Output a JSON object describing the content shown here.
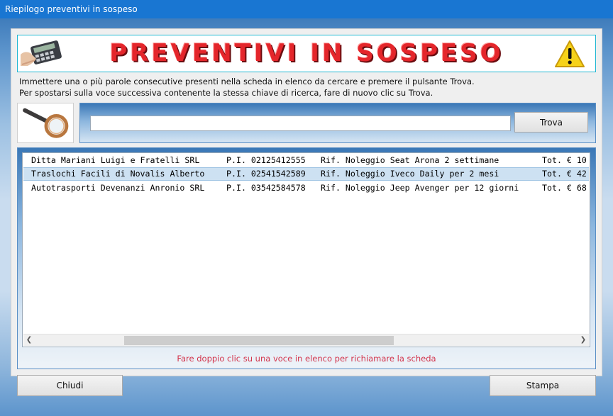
{
  "window": {
    "title": "Riepilogo preventivi in sospeso"
  },
  "banner": {
    "title": "PREVENTIVI IN SOSPESO"
  },
  "instructions": {
    "line1": "Immettere una o più parole consecutive presenti nella scheda in elenco da cercare e premere il pulsante Trova.",
    "line2": "Per spostarsi sulla voce successiva contenente la stessa chiave di ricerca, fare di nuovo clic su Trova."
  },
  "search": {
    "value": "",
    "button_label": "Trova"
  },
  "list": {
    "selected_index": 1,
    "rows": [
      {
        "name": "Ditta Mariani Luigi e Fratelli SRL",
        "piva": "P.I. 02125412555",
        "rif": "Rif. Noleggio Seat Arona 2 settimane",
        "tot": "Tot. € 10"
      },
      {
        "name": "Traslochi Facili di Novalis Alberto",
        "piva": "P.I. 02541542589",
        "rif": "Rif. Noleggio Iveco Daily per 2 mesi",
        "tot": "Tot. € 42"
      },
      {
        "name": "Autotrasporti Devenanzi Anronio SRL",
        "piva": "P.I. 03542584578",
        "rif": "Rif. Noleggio Jeep Avenger per 12 giorni",
        "tot": "Tot. € 68"
      }
    ]
  },
  "hint": "Fare doppio clic su una voce in elenco per richiamare la scheda",
  "footer": {
    "close_label": "Chiudi",
    "print_label": "Stampa"
  },
  "icons": {
    "banner_left": "calculator-icon",
    "banner_right": "warning-icon",
    "search": "magnifier-icon"
  },
  "colors": {
    "accent": "#1976d2",
    "title_red": "#e4262b",
    "hint": "#d3344c"
  }
}
